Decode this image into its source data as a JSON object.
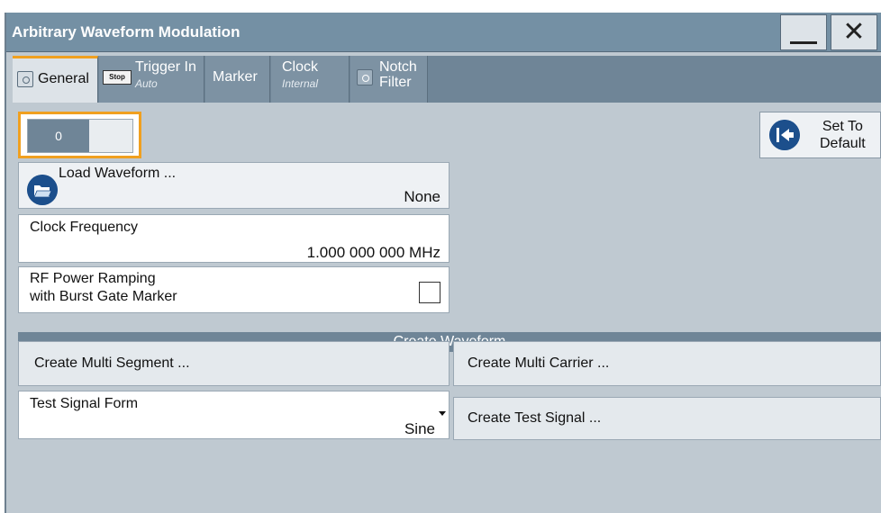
{
  "window": {
    "title": "Arbitrary Waveform Modulation"
  },
  "tabs": [
    {
      "label": "General",
      "active": true
    },
    {
      "label": "Trigger In",
      "sub": "Auto",
      "badge": "Stop"
    },
    {
      "label": "Marker"
    },
    {
      "label": "Clock",
      "sub": "Internal"
    },
    {
      "label": "Notch",
      "label2": "Filter"
    }
  ],
  "state_toggle": {
    "value": "0"
  },
  "set_default": {
    "line1": "Set To",
    "line2": "Default"
  },
  "load_waveform": {
    "label": "Load Waveform ...",
    "value": "None"
  },
  "clock_frequency": {
    "label": "Clock Frequency",
    "value": "1.000 000 000 MHz"
  },
  "rf_power_ramping": {
    "line1": "RF Power Ramping",
    "line2": "with Burst Gate Marker",
    "checked": false
  },
  "create_waveform": {
    "section_label": "Create Waveform",
    "multi_segment": "Create Multi Segment ...",
    "multi_carrier": "Create Multi Carrier ...",
    "test_signal_form": {
      "label": "Test Signal Form",
      "value": "Sine"
    },
    "create_test_signal": "Create Test Signal ..."
  },
  "colors": {
    "accent": "#f0a020",
    "titlebar": "#7490a4",
    "section": "#6f8597",
    "icon_blue": "#1c4f8c"
  }
}
